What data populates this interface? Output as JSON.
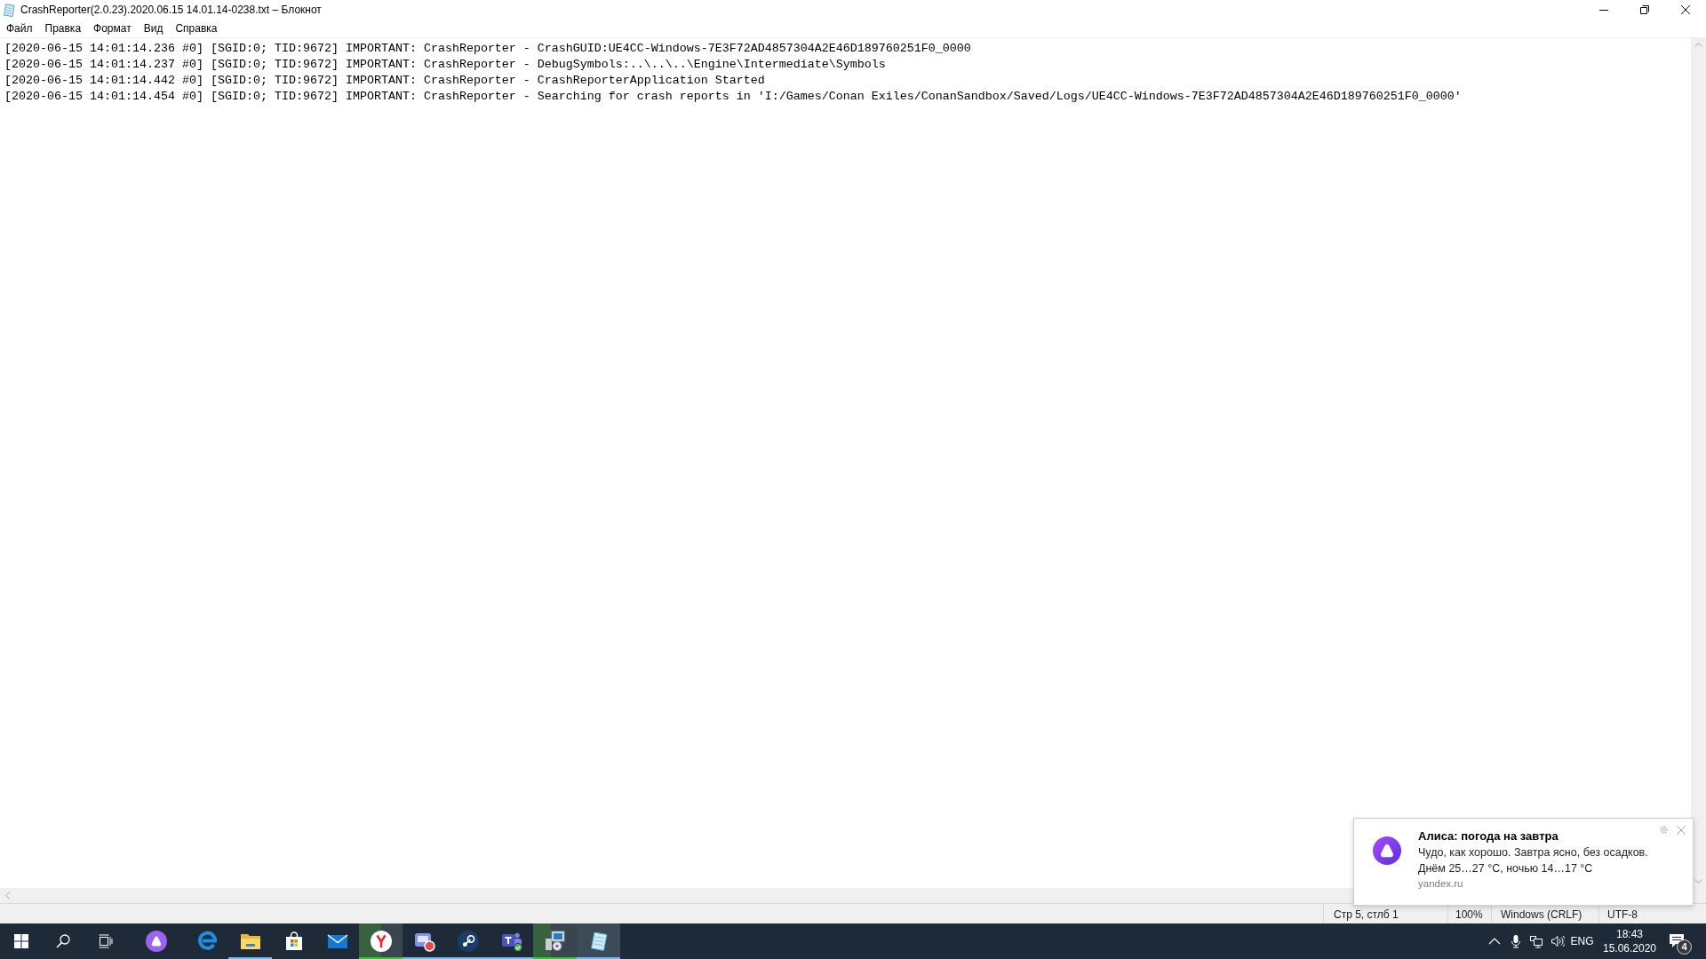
{
  "window": {
    "title": "CrashReporter(2.0.23).2020.06.15 14.01.14-0238.txt – Блокнот"
  },
  "menu": [
    "Файл",
    "Правка",
    "Формат",
    "Вид",
    "Справка"
  ],
  "editor": {
    "lines": [
      "[2020-06-15 14:01:14.236 #0] [SGID:0; TID:9672] IMPORTANT: CrashReporter - CrashGUID:UE4CC-Windows-7E3F72AD4857304A2E46D189760251F0_0000",
      "[2020-06-15 14:01:14.237 #0] [SGID:0; TID:9672] IMPORTANT: CrashReporter - DebugSymbols:..\\..\\..\\Engine\\Intermediate\\Symbols",
      "[2020-06-15 14:01:14.442 #0] [SGID:0; TID:9672] IMPORTANT: CrashReporter - CrashReporterApplication Started",
      "[2020-06-15 14:01:14.454 #0] [SGID:0; TID:9672] IMPORTANT: CrashReporter - Searching for crash reports in 'I:/Games/Conan Exiles/ConanSandbox/Saved/Logs/UE4CC-Windows-7E3F72AD4857304A2E46D189760251F0_0000'"
    ]
  },
  "status_bar": [
    "Стр 5, стлб 1",
    "100%",
    "Windows (CRLF)",
    "UTF-8"
  ],
  "notification": {
    "title": "Алиса: погода на завтра",
    "body": [
      "Чудо, как хорошо. Завтра ясно, без осадков.",
      "Днём 25…27 °C, ночью 14…17 °C"
    ],
    "source": "yandex.ru"
  },
  "taskbar": {
    "apps": [
      {
        "kind": "assistant",
        "running": false,
        "active": false
      },
      {
        "kind": "browser",
        "running": false,
        "active": false
      },
      {
        "kind": "folder",
        "running": true,
        "active": false
      },
      {
        "kind": "store",
        "running": false,
        "active": false
      },
      {
        "kind": "mail",
        "running": false,
        "active": false
      },
      {
        "kind": "y-browser",
        "running": true,
        "active": false,
        "level": 0.5
      },
      {
        "kind": "recorder",
        "running": true,
        "active": false
      },
      {
        "kind": "game-client",
        "running": true,
        "active": false
      },
      {
        "kind": "team-chat",
        "running": true,
        "active": false
      },
      {
        "kind": "installer",
        "running": true,
        "active": false,
        "level": 0.4
      },
      {
        "kind": "notepad",
        "running": true,
        "active": true
      }
    ],
    "tray": {
      "language": "ENG",
      "time": "18:43",
      "date": "15.06.2020",
      "notifications": "4"
    }
  }
}
